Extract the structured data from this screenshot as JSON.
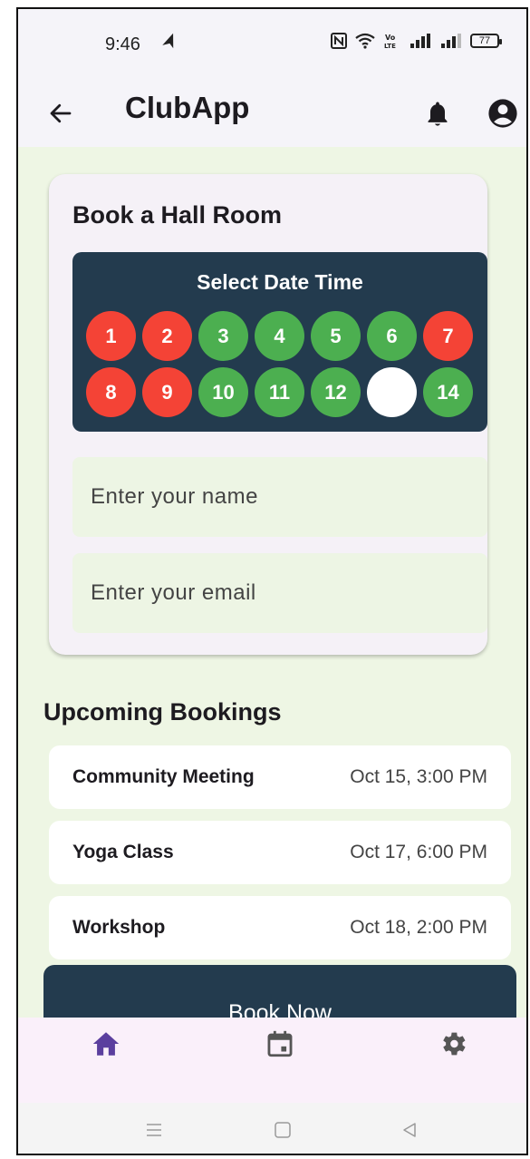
{
  "status_bar": {
    "time": "9:46",
    "battery": "77"
  },
  "app_bar": {
    "title": "ClubApp",
    "icons": [
      "back-arrow-icon",
      "bell-icon",
      "account-circle-icon"
    ]
  },
  "booking_card": {
    "title": "Book a Hall Room",
    "date_panel": {
      "title": "Select Date Time",
      "days": [
        {
          "label": "1",
          "status": "red"
        },
        {
          "label": "2",
          "status": "red"
        },
        {
          "label": "3",
          "status": "green"
        },
        {
          "label": "4",
          "status": "green"
        },
        {
          "label": "5",
          "status": "green"
        },
        {
          "label": "6",
          "status": "green"
        },
        {
          "label": "7",
          "status": "red"
        },
        {
          "label": "8",
          "status": "red"
        },
        {
          "label": "9",
          "status": "red"
        },
        {
          "label": "10",
          "status": "green"
        },
        {
          "label": "11",
          "status": "green"
        },
        {
          "label": "12",
          "status": "green"
        },
        {
          "label": "",
          "status": "white"
        },
        {
          "label": "14",
          "status": "green"
        }
      ]
    },
    "name_field": {
      "placeholder": "Enter your name",
      "value": ""
    },
    "email_field": {
      "placeholder": "Enter your email",
      "value": ""
    }
  },
  "upcoming": {
    "title": "Upcoming Bookings",
    "items": [
      {
        "name": "Community Meeting",
        "time": "Oct 15, 3:00 PM"
      },
      {
        "name": "Yoga Class",
        "time": "Oct 17, 6:00 PM"
      },
      {
        "name": "Workshop",
        "time": "Oct 18, 2:00 PM"
      }
    ]
  },
  "book_button": {
    "label": "Book Now"
  },
  "bottom_nav": {
    "items": [
      {
        "icon": "home-icon",
        "active": true
      },
      {
        "icon": "calendar-icon",
        "active": false
      },
      {
        "icon": "settings-icon",
        "active": false
      }
    ]
  },
  "colors": {
    "primary_dark": "#233b4e",
    "booked_red": "#f44336",
    "available_green": "#4caf50",
    "nav_active": "#5b3f9e",
    "background": "#eef6e4"
  }
}
